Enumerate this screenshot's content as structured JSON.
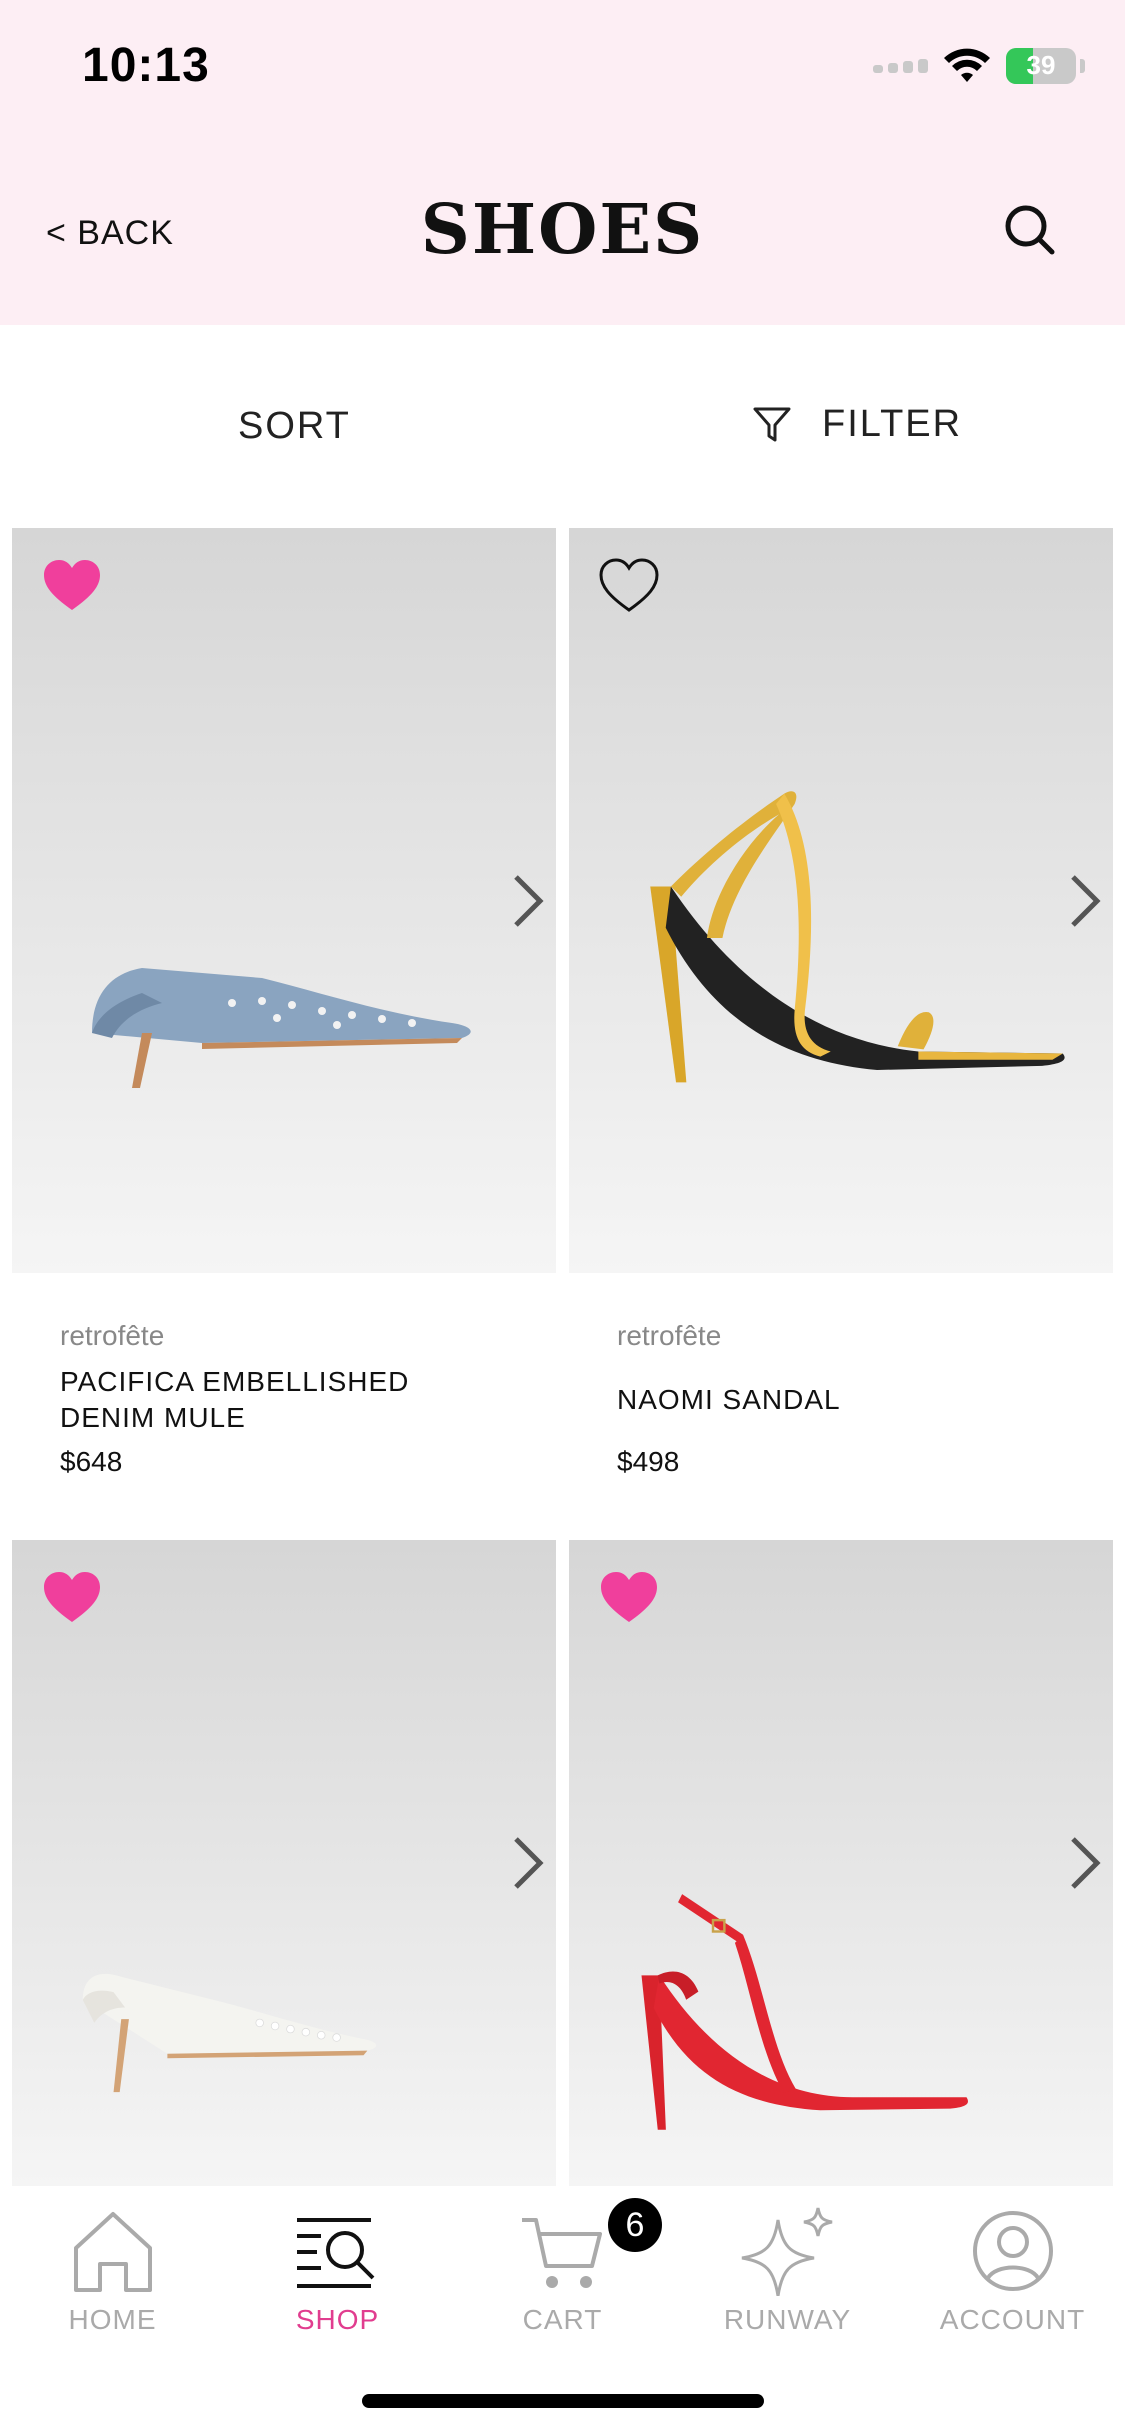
{
  "status_bar": {
    "time": "10:13",
    "battery": "39"
  },
  "header": {
    "back_label": "< BACK",
    "title": "SHOES"
  },
  "toolbar": {
    "sort_label": "SORT",
    "filter_label": "FILTER"
  },
  "products": [
    {
      "brand": "retrofête",
      "name": "PACIFICA EMBELLISHED DENIM MULE",
      "price": "$648",
      "favorited": true,
      "shoe": "denim-mule"
    },
    {
      "brand": "retrofête",
      "name": "NAOMI SANDAL",
      "price": "$498",
      "favorited": false,
      "shoe": "gold-sandal"
    },
    {
      "brand": "",
      "name": "",
      "price": "",
      "favorited": true,
      "shoe": "white-mule"
    },
    {
      "brand": "",
      "name": "",
      "price": "",
      "favorited": true,
      "shoe": "red-slingback"
    }
  ],
  "tabbar": {
    "items": [
      {
        "label": "HOME",
        "icon": "home-icon"
      },
      {
        "label": "SHOP",
        "icon": "shop-icon",
        "active": true
      },
      {
        "label": "CART",
        "icon": "cart-icon"
      },
      {
        "label": "RUNWAY",
        "icon": "sparkle-icon"
      },
      {
        "label": "ACCOUNT",
        "icon": "account-icon"
      }
    ],
    "cart_count": "6"
  },
  "colors": {
    "accent": "#e13d8f",
    "header_bg": "#fdeef4",
    "heart": "#f03f9c"
  }
}
